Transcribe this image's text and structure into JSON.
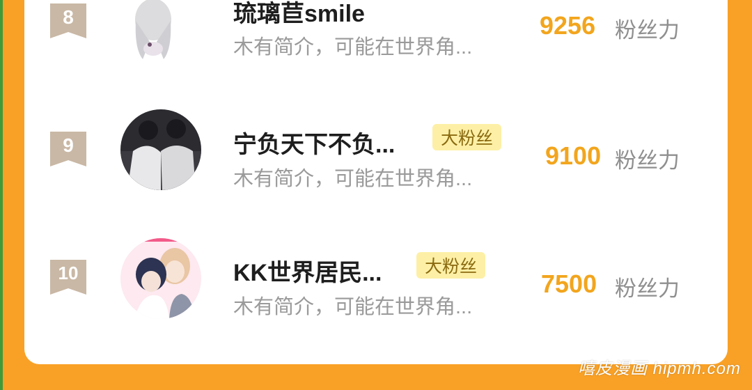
{
  "ranking": [
    {
      "rank": "8",
      "name": "琉璃苣smile",
      "badge": "",
      "bio": "木有简介，可能在世界角...",
      "score": "9256",
      "unit": "粉丝力"
    },
    {
      "rank": "9",
      "name": "宁负天下不负...",
      "badge": "大粉丝",
      "bio": "木有简介，可能在世界角...",
      "score": "9100",
      "unit": "粉丝力"
    },
    {
      "rank": "10",
      "name": "KK世界居民...",
      "badge": "大粉丝",
      "bio": "木有简介，可能在世界角...",
      "score": "7500",
      "unit": "粉丝力"
    }
  ],
  "watermark": "嘻皮漫画 hipmh.com",
  "colors": {
    "page_background": "#f9a126",
    "card_background": "#ffffff",
    "rank_badge": "#c9b8a5",
    "score": "#f2a51d",
    "fan_badge_bg": "#fdf0a6"
  }
}
